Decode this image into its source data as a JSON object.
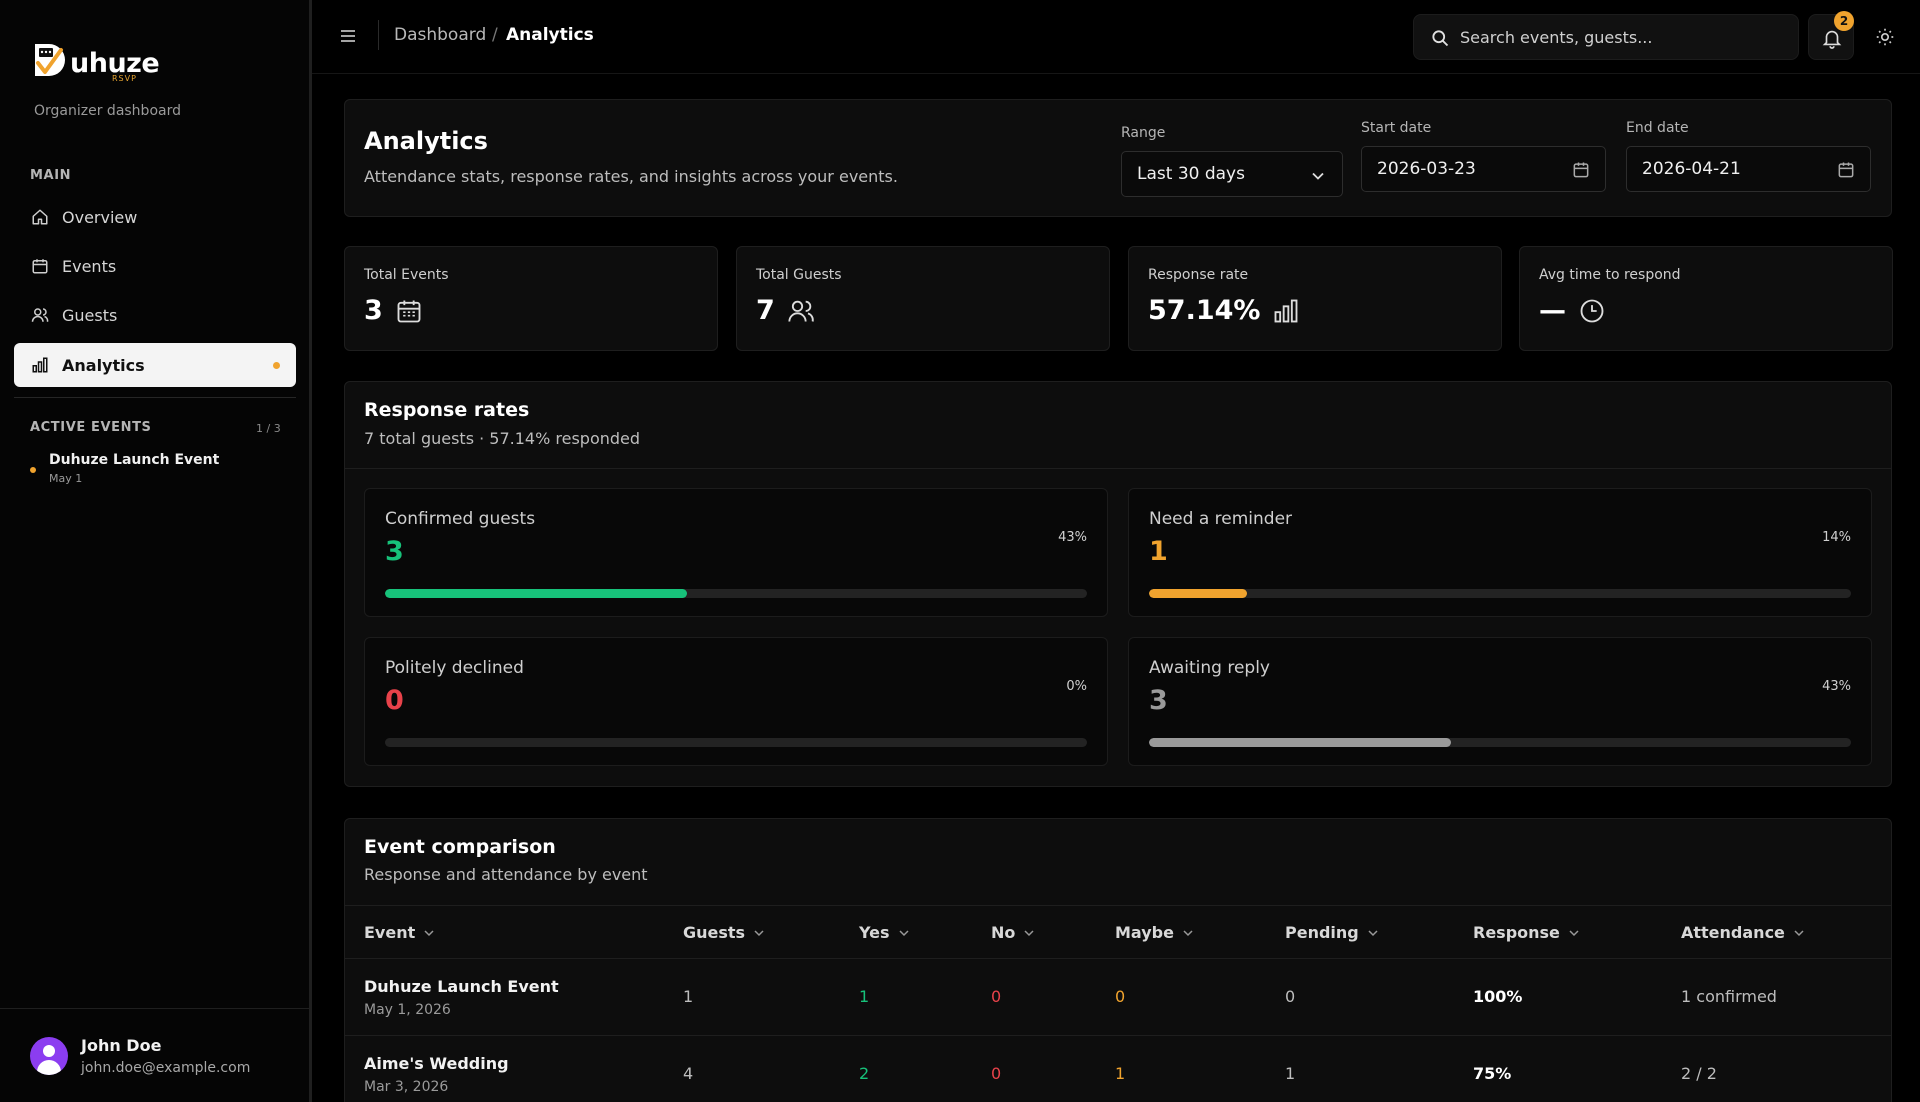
{
  "brand": {
    "name": "uhuze",
    "sub": "RSVP",
    "org_label": "Organizer dashboard"
  },
  "sidebar": {
    "main_label": "MAIN",
    "items": [
      {
        "label": "Overview"
      },
      {
        "label": "Events"
      },
      {
        "label": "Guests"
      },
      {
        "label": "Analytics"
      }
    ],
    "active_label": "ACTIVE EVENTS",
    "active_count": "1 / 3",
    "active_event": {
      "name": "Duhuze Launch Event",
      "date": "May 1"
    }
  },
  "user": {
    "name": "John Doe",
    "email": "john.doe@example.com"
  },
  "topbar": {
    "breadcrumb": [
      "Dashboard",
      "Analytics"
    ],
    "breadcrumb_sep": "/",
    "search_placeholder": "Search events, guests...",
    "notification_count": "2"
  },
  "header": {
    "title": "Analytics",
    "subtitle": "Attendance stats, response rates, and insights across your events.",
    "range_label": "Range",
    "range_value": "Last 30 days",
    "start_label": "Start date",
    "start_value": "2026-03-23",
    "end_label": "End date",
    "end_value": "2026-04-21"
  },
  "stats": [
    {
      "label": "Total Events",
      "value": "3",
      "icon": "calendar-icon"
    },
    {
      "label": "Total Guests",
      "value": "7",
      "icon": "users-icon"
    },
    {
      "label": "Response rate",
      "value": "57.14%",
      "icon": "bar-chart-icon"
    },
    {
      "label": "Avg time to respond",
      "value": "—",
      "icon": "clock-icon"
    }
  ],
  "rates": {
    "title": "Response rates",
    "subtitle": "7 total guests · 57.14% responded",
    "items": [
      {
        "label": "Confirmed guests",
        "value": "3",
        "pct": "43%",
        "fraction": 0.43,
        "color": "#17c27a"
      },
      {
        "label": "Need a reminder",
        "value": "1",
        "pct": "14%",
        "fraction": 0.14,
        "color": "#f0a32e"
      },
      {
        "label": "Politely declined",
        "value": "0",
        "pct": "0%",
        "fraction": 0.0,
        "color": "#e8424a"
      },
      {
        "label": "Awaiting reply",
        "value": "3",
        "pct": "43%",
        "fraction": 0.43,
        "color": "#9a9a9a"
      }
    ]
  },
  "comparison": {
    "title": "Event comparison",
    "subtitle": "Response and attendance by event",
    "columns": [
      "Event",
      "Guests",
      "Yes",
      "No",
      "Maybe",
      "Pending",
      "Response",
      "Attendance"
    ],
    "rows": [
      {
        "event": "Duhuze Launch Event",
        "date": "May 1, 2026",
        "guests": "1",
        "yes": "1",
        "no": "0",
        "maybe": "0",
        "pending": "0",
        "response": "100%",
        "attendance": "1 confirmed"
      },
      {
        "event": "Aime's Wedding",
        "date": "Mar 3, 2026",
        "guests": "4",
        "yes": "2",
        "no": "0",
        "maybe": "1",
        "pending": "1",
        "response": "75%",
        "attendance": "2 / 2"
      }
    ]
  },
  "colors": {
    "accent": "#f0a32e",
    "yes": "#17c27a",
    "no": "#e8424a",
    "maybe": "#f0a32e"
  }
}
